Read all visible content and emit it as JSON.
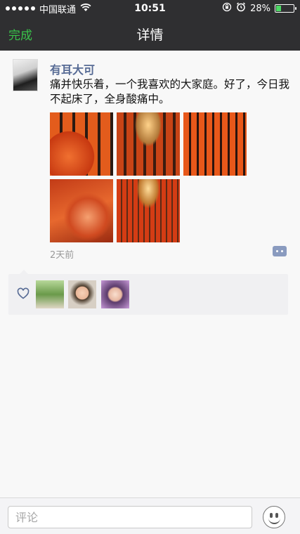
{
  "status_bar": {
    "carrier": "中国联通",
    "time": "10:51",
    "battery": "28%",
    "battery_level": 0.28,
    "icons": [
      "signal-dots-icon",
      "wifi-icon",
      "orientation-lock-icon",
      "alarm-icon",
      "battery-icon"
    ]
  },
  "nav": {
    "back_label": "完成",
    "title": "详情"
  },
  "post": {
    "author": "有耳大可",
    "text": "痛并快乐着，一个我喜欢的大家庭。好了，今日我不起床了，全身酸痛中。",
    "time_ago": "2天前",
    "photo_count": 5,
    "liker_count": 3
  },
  "comment_bar": {
    "placeholder": "评论"
  },
  "colors": {
    "accent_green": "#39c34a",
    "link_blue": "#576b95",
    "nav_bg": "#2f2f31"
  }
}
